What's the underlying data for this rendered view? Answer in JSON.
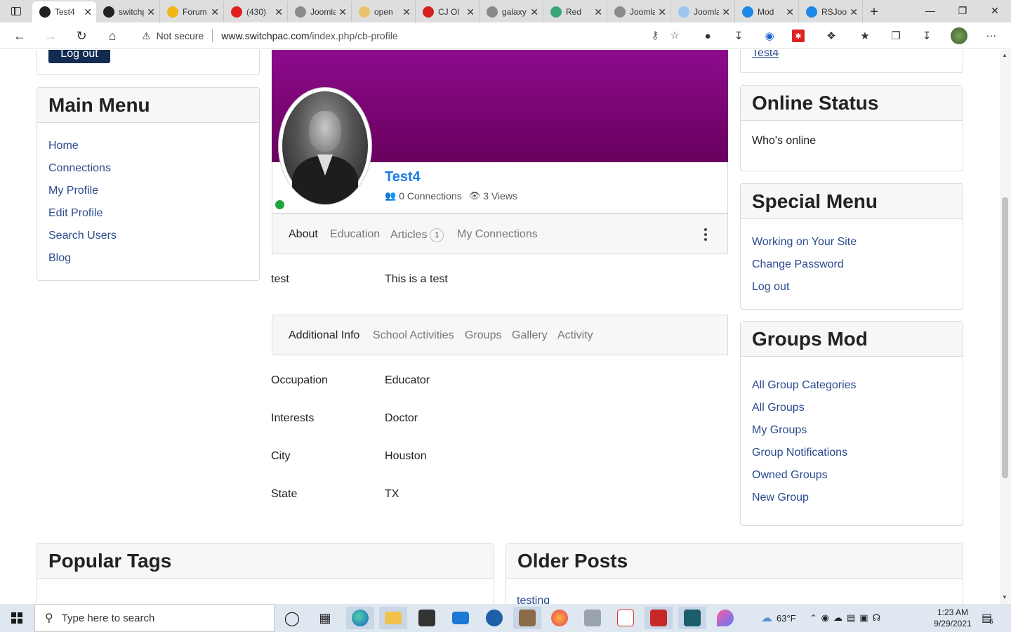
{
  "browser": {
    "tabs": [
      {
        "title": "Test4",
        "favicon": "joomla-icon",
        "color": "#222222",
        "active": true
      },
      {
        "title": "switchpac",
        "favicon": "joomla-icon",
        "color": "#222222"
      },
      {
        "title": "Forum",
        "favicon": "forum-icon",
        "color": "#f2b417"
      },
      {
        "title": "(430)",
        "favicon": "youtube-icon",
        "color": "#e02020"
      },
      {
        "title": "Joomla",
        "favicon": "checkmark-icon",
        "color": "#8a8a8a"
      },
      {
        "title": "open",
        "favicon": "chat-icon",
        "color": "#e9c46a"
      },
      {
        "title": "CJ Ol",
        "favicon": "cj-icon",
        "color": "#d42020"
      },
      {
        "title": "galaxy",
        "favicon": "google-icon",
        "color": "#888888"
      },
      {
        "title": "Red",
        "favicon": "d-icon",
        "color": "#3aa57a"
      },
      {
        "title": "Joomla",
        "favicon": "checkmark-icon",
        "color": "#8a8a8a"
      },
      {
        "title": "Joomla",
        "favicon": "rs-icon",
        "color": "#9ec5f0"
      },
      {
        "title": "Mod",
        "favicon": "rs-icon",
        "color": "#1e88e5"
      },
      {
        "title": "RSJoomla",
        "favicon": "rs-icon",
        "color": "#1e88e5"
      }
    ],
    "security_label": "Not secure",
    "url_host": "www.switchpac.com",
    "url_path": "/index.php/cb-profile"
  },
  "left": {
    "logout_button": "Log out",
    "main_menu": {
      "title": "Main Menu",
      "items": [
        "Home",
        "Connections",
        "My Profile",
        "Edit Profile",
        "Search Users",
        "Blog"
      ]
    }
  },
  "profile": {
    "username": "Test4",
    "connections": "0 Connections",
    "views": "3 Views",
    "tabs": [
      "About",
      "Education",
      "Articles",
      "My Connections"
    ],
    "articles_count": "1",
    "about_field": {
      "label": "test",
      "value": "This is a test"
    },
    "secondary_tabs": [
      "Additional Info",
      "School Activities",
      "Groups",
      "Gallery",
      "Activity"
    ],
    "info": [
      {
        "label": "Occupation",
        "value": "Educator"
      },
      {
        "label": "Interests",
        "value": "Doctor"
      },
      {
        "label": "City",
        "value": "Houston"
      },
      {
        "label": "State",
        "value": "TX"
      }
    ]
  },
  "right": {
    "top_link": "Test4",
    "online_status": {
      "title": "Online Status",
      "text": "Who's online"
    },
    "special_menu": {
      "title": "Special Menu",
      "items": [
        "Working on Your Site",
        "Change Password",
        "Log out"
      ]
    },
    "groups_mod": {
      "title": "Groups Mod",
      "items": [
        "All Group Categories",
        "All Groups",
        "My Groups",
        "Group Notifications",
        "Owned Groups",
        "New Group"
      ]
    }
  },
  "bottom": {
    "popular_tags": "Popular Tags",
    "older_posts": {
      "title": "Older Posts",
      "first_item": "testing"
    }
  },
  "taskbar": {
    "search_placeholder": "Type here to search",
    "temperature": "63°F",
    "time": "1:23 AM",
    "date": "9/29/2021",
    "notifications": "6"
  }
}
